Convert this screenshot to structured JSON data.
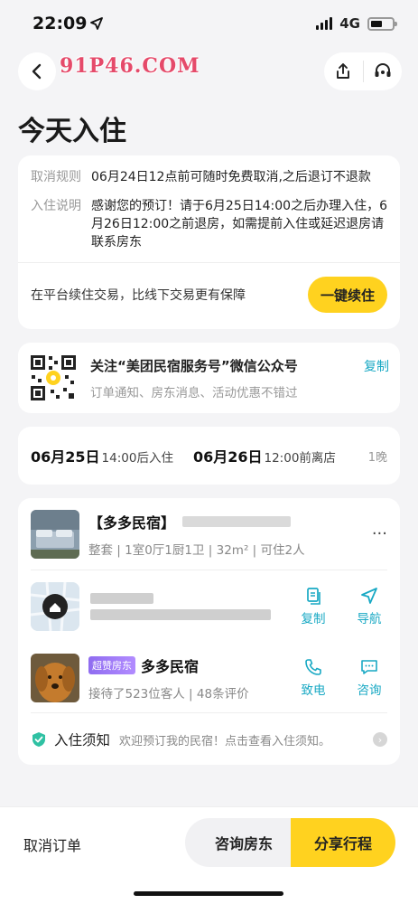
{
  "status_bar": {
    "time": "22:09",
    "network": "4G"
  },
  "watermark": {
    "text": "91P46.COM"
  },
  "page": {
    "title": "今天入住"
  },
  "policy": {
    "cancel_label": "取消规则",
    "cancel_text": "06月24日12点前可随时免费取消,之后退订不退款",
    "checkin_label": "入住说明",
    "checkin_text": "感谢您的预订！请于6月25日14:00之后办理入住，6月26日12:00之前退房，如需提前入住或延迟退房请联系房东",
    "renew_text": "在平台续住交易，比线下交易更有保障",
    "renew_button": "一键续住"
  },
  "wechat": {
    "title": "关注“美团民宿服务号”微信公众号",
    "subtitle": "订单通知、房东消息、活动优惠不错过",
    "copy_label": "复制"
  },
  "stay": {
    "checkin_date": "06月25日",
    "checkin_note": "14:00后入住",
    "checkout_date": "06月26日",
    "checkout_note": "12:00前离店",
    "nights": "1晚"
  },
  "listing": {
    "name": "【多多民宿】",
    "meta": "整套 | 1室0厅1厨1卫 | 32m² | 可住2人",
    "more": "···"
  },
  "address": {
    "copy_label": "复制",
    "navigate_label": "导航"
  },
  "host": {
    "badge": "超赞房东",
    "name": "多多民宿",
    "meta": "接待了523位客人 | 48条评价",
    "call_label": "致电",
    "consult_label": "咨询"
  },
  "notice": {
    "title": "入住须知",
    "text": "欢迎预订我的民宿！点击查看入住须知。"
  },
  "bottom": {
    "cancel_label": "取消订单",
    "consult_button": "咨询房东",
    "share_button": "分享行程"
  },
  "colors": {
    "accent": "#ffd21f",
    "link": "#19a9c4",
    "badge": "#9a75f2"
  }
}
